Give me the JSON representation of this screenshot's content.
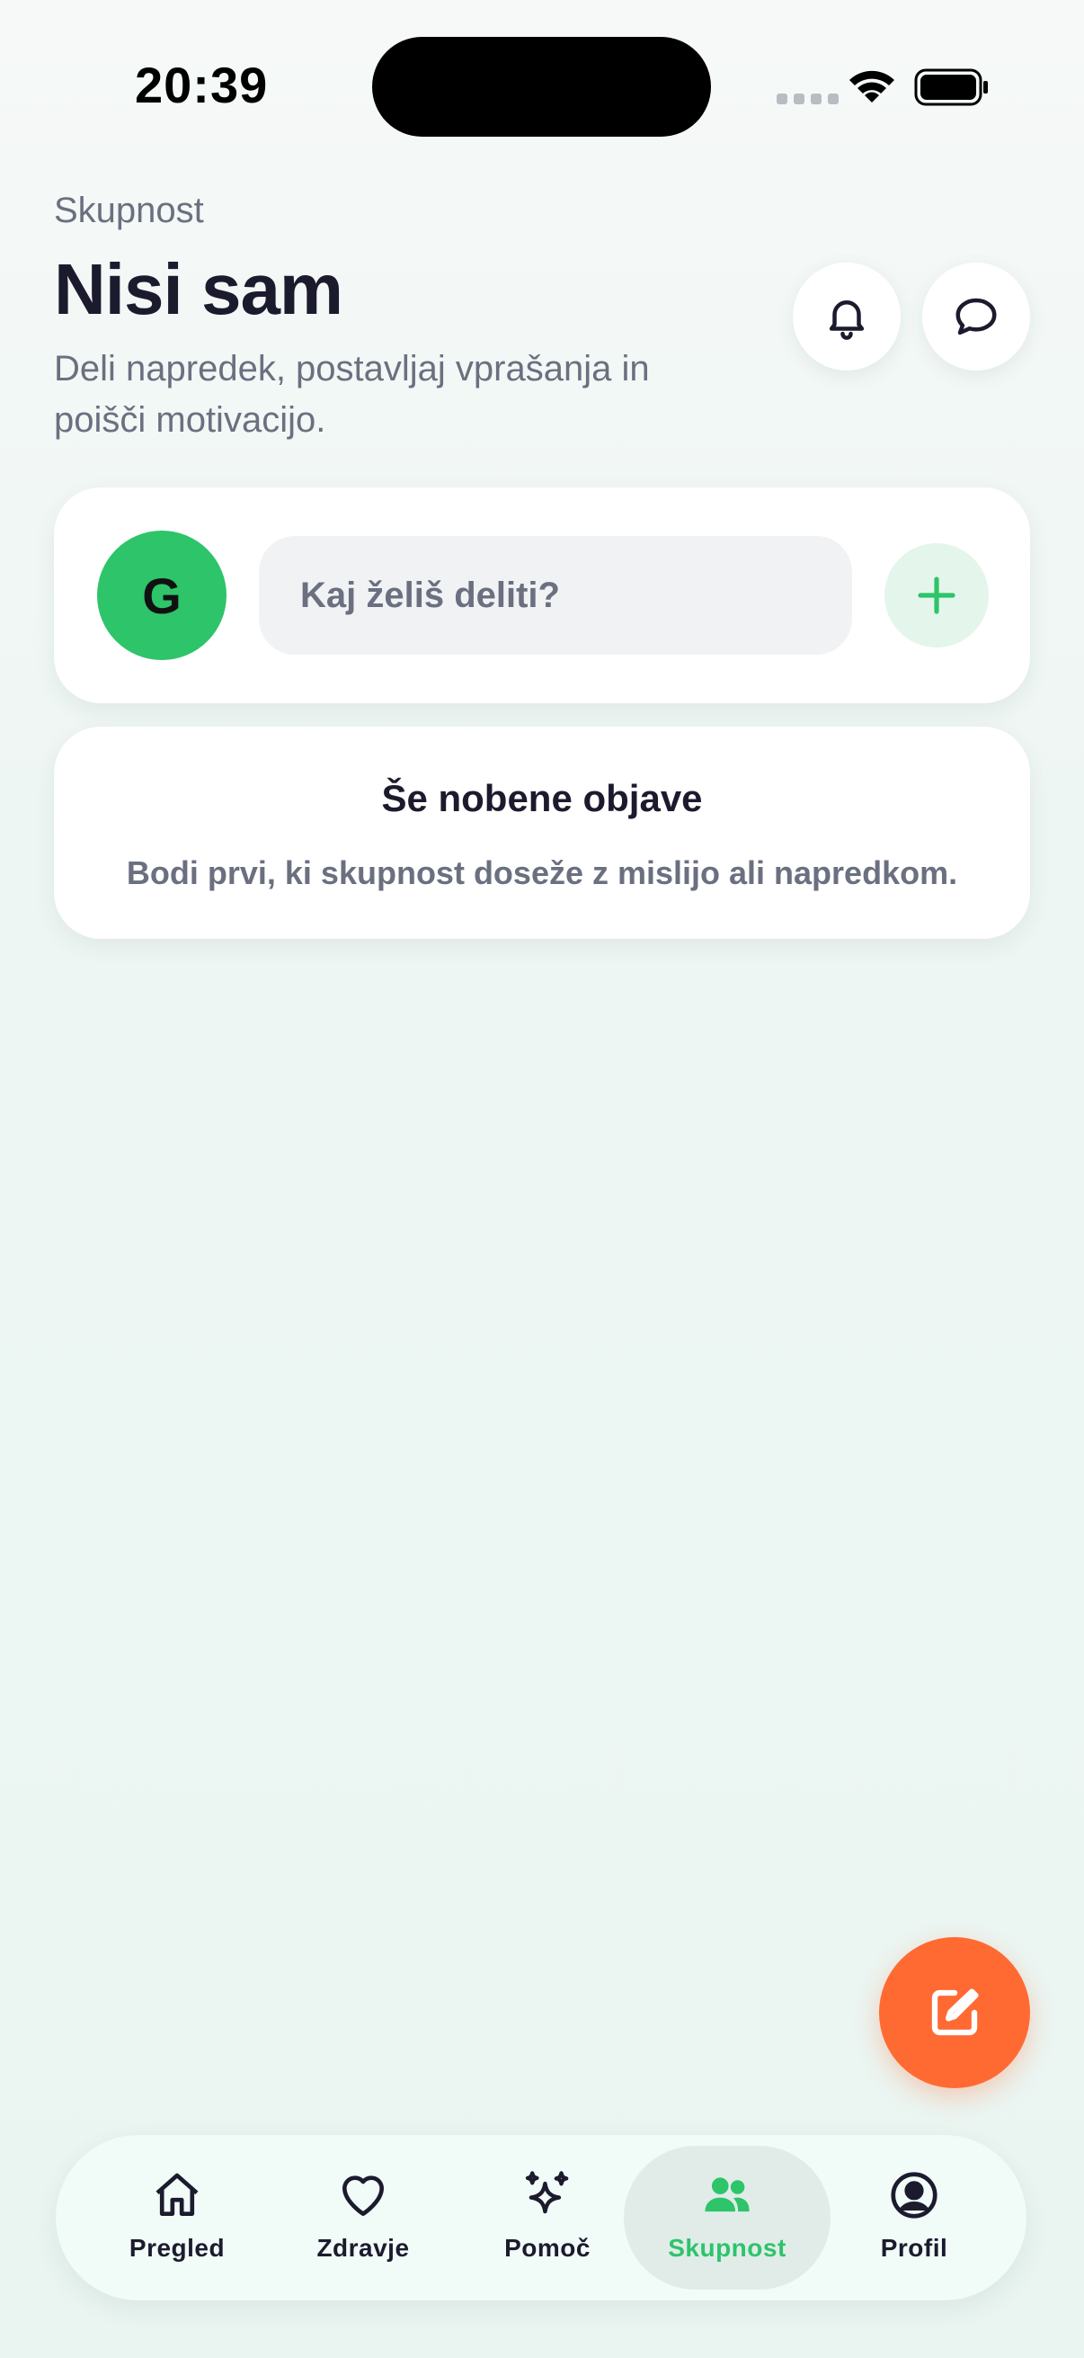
{
  "status_bar": {
    "time": "20:39"
  },
  "header": {
    "eyebrow": "Skupnost",
    "title": "Nisi sam",
    "subtitle": "Deli napredek, postavljaj vprašanja in poišči motivacijo.",
    "icons": [
      "bell-icon",
      "chat-bubble-icon"
    ]
  },
  "composer": {
    "avatar_initial": "G",
    "placeholder": "Kaj želiš deliti?",
    "add_icon": "plus-icon"
  },
  "empty_state": {
    "title": "Še nobene objave",
    "text": "Bodi prvi, ki skupnost doseže z mislijo ali napredkom."
  },
  "fab": {
    "icon": "edit-icon"
  },
  "tabbar": {
    "active": "Skupnost",
    "items": [
      {
        "label": "Pregled",
        "icon": "home-icon"
      },
      {
        "label": "Zdravje",
        "icon": "heart-icon"
      },
      {
        "label": "Pomoč",
        "icon": "sparkles-icon"
      },
      {
        "label": "Skupnost",
        "icon": "users-icon"
      },
      {
        "label": "Profil",
        "icon": "profile-icon"
      }
    ]
  },
  "colors": {
    "accent_green": "#2ec46a",
    "fab_orange": "#ff6a33",
    "text_dark": "#1c1b2e",
    "text_muted": "#6b7080"
  }
}
